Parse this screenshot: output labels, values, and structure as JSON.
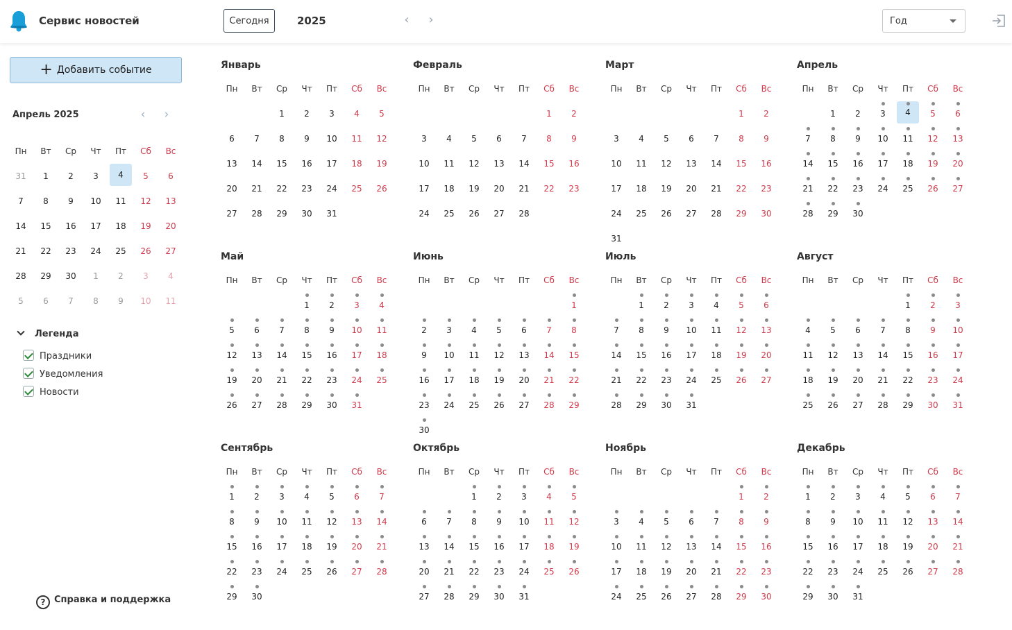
{
  "header": {
    "app_title": "Сервис новостей",
    "today_label": "Сегодня",
    "year": "2025",
    "view_value": "Год",
    "prev_icon": "chevron-left-icon",
    "next_icon": "chevron-right-icon",
    "logout_icon": "logout-icon"
  },
  "sidebar": {
    "add_event_label": "Добавить событие",
    "mini_calendar": {
      "title": "Апрель 2025",
      "today": 4,
      "weekdays": [
        "Пн",
        "Вт",
        "Ср",
        "Чт",
        "Пт",
        "Сб",
        "Вс"
      ],
      "weeks": [
        [
          "31",
          "1",
          "2",
          "3",
          "4",
          "5",
          "6"
        ],
        [
          "7",
          "8",
          "9",
          "10",
          "11",
          "12",
          "13"
        ],
        [
          "14",
          "15",
          "16",
          "17",
          "18",
          "19",
          "20"
        ],
        [
          "21",
          "22",
          "23",
          "24",
          "25",
          "26",
          "27"
        ],
        [
          "28",
          "29",
          "30",
          "1",
          "2",
          "3",
          "4"
        ],
        [
          "5",
          "6",
          "7",
          "8",
          "9",
          "10",
          "11"
        ]
      ]
    },
    "legend": {
      "title": "Легенда",
      "items": [
        "Праздники",
        "Уведомления",
        "Новости"
      ]
    },
    "help_label": "Справка и поддержка"
  },
  "year_view": {
    "weekdays": [
      "Пн",
      "Вт",
      "Ср",
      "Чт",
      "Пт",
      "Сб",
      "Вс"
    ],
    "today_month": 4,
    "today_day": 4,
    "event_start": "2025-04-03",
    "months": [
      {
        "name": "Январь",
        "offset": 2,
        "days": 31
      },
      {
        "name": "Февраль",
        "offset": 5,
        "days": 28
      },
      {
        "name": "Март",
        "offset": 5,
        "days": 31
      },
      {
        "name": "Апрель",
        "offset": 1,
        "days": 30
      },
      {
        "name": "Май",
        "offset": 3,
        "days": 31
      },
      {
        "name": "Июнь",
        "offset": 6,
        "days": 30
      },
      {
        "name": "Июль",
        "offset": 1,
        "days": 31
      },
      {
        "name": "Август",
        "offset": 4,
        "days": 31
      },
      {
        "name": "Сентябрь",
        "offset": 0,
        "days": 30
      },
      {
        "name": "Октябрь",
        "offset": 2,
        "days": 31
      },
      {
        "name": "Ноябрь",
        "offset": 5,
        "days": 30
      },
      {
        "name": "Декабрь",
        "offset": 0,
        "days": 31
      }
    ]
  }
}
